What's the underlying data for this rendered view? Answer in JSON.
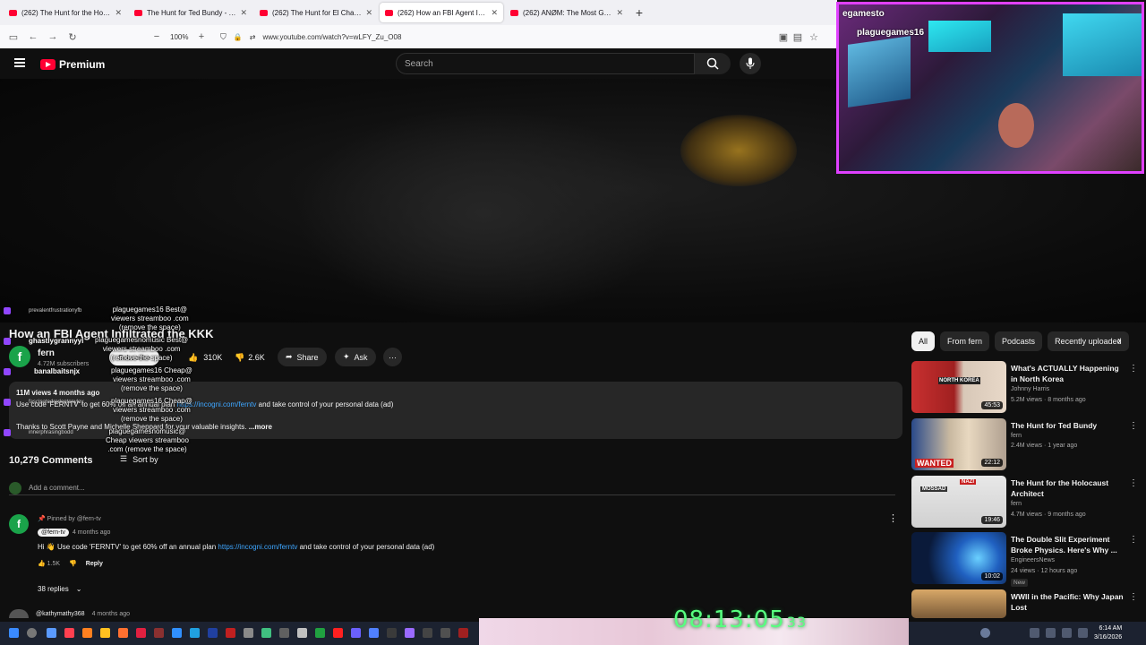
{
  "browser": {
    "tabs": [
      {
        "title": "(262) The Hunt for the Holocau",
        "active": false
      },
      {
        "title": "The Hunt for Ted Bundy - YouTu",
        "active": false
      },
      {
        "title": "(262) The Hunt for El Chapo - Y",
        "active": false
      },
      {
        "title": "(262) How an FBI Agent Infiltrat",
        "active": true
      },
      {
        "title": "(262) ANØM: The Most Genius",
        "active": false
      }
    ],
    "new_tab": "+",
    "zoom": "100%",
    "zoom_minus": "−",
    "zoom_plus": "+",
    "url": "www.youtube.com/watch?v=wLFY_Zu_O08"
  },
  "youtube": {
    "logo_text": "Premium",
    "search_placeholder": "Search"
  },
  "stream_overlay": {
    "cam_name": "egamesto",
    "cam_name2": "plaguegames16",
    "clock": "08:13:05",
    "clock_small": "33"
  },
  "video": {
    "title": "How an FBI Agent Infiltrated the KKK",
    "channel": "fern",
    "subscribers": "4.72M subscribers",
    "subscribe_label": "Subscribe",
    "likes": "310K",
    "dislikes": "2.6K",
    "share_label": "Share",
    "ask_label": "Ask",
    "more_label": "···"
  },
  "description": {
    "views": "11M views  4 months ago",
    "promo_prefix": "Use code 'FERNTV' to get 60% off an annual plan ",
    "promo_link": "https://incogni.com/ferntv",
    "promo_suffix": " and take control of your personal data (ad)",
    "thanks": "Thanks to Scott Payne and Michelle Sheppard for your valuable insights. ",
    "more": "...more"
  },
  "comments": {
    "count": "10,279 Comments",
    "sort_label": "Sort by",
    "add_placeholder": "Add a comment...",
    "pinned": {
      "pinned_label": "Pinned by @fern-tv",
      "author": "@fern-tv",
      "time": "4 months ago",
      "text_prefix": "Hi 👋 Use code 'FERNTV' to get 60% off an annual plan ",
      "link": "https://incogni.com/ferntv",
      "text_suffix": " and take control of your personal data (ad)",
      "likes": "1.5K",
      "reply_label": "Reply",
      "replies": "38 replies"
    },
    "next": {
      "author": "@kathymathy368",
      "time": "4 months ago"
    }
  },
  "chips": [
    "All",
    "From fern",
    "Podcasts",
    "Recently uploaded"
  ],
  "related": [
    {
      "title": "What's ACTUALLY Happening in North Korea",
      "channel": "Johnny Harris",
      "meta": "5.2M views · 8 months ago",
      "duration": "45:53",
      "thumb_text": "NORTH KOREA",
      "badge": ""
    },
    {
      "title": "The Hunt for Ted Bundy",
      "channel": "fern",
      "meta": "2.4M views · 1 year ago",
      "duration": "22:12",
      "thumb_text": "WANTED",
      "badge": ""
    },
    {
      "title": "The Hunt for the Holocaust Architect",
      "channel": "fern",
      "meta": "4.7M views · 9 months ago",
      "duration": "19:46",
      "thumb_text": "NAZI",
      "thumb_text2": "MOSSAD",
      "badge": ""
    },
    {
      "title": "The Double Slit Experiment Broke Physics. Here's Why ...",
      "channel": "EngineersNews",
      "meta": "24 views · 12 hours ago",
      "duration": "10:02",
      "thumb_text": "",
      "badge": "New"
    },
    {
      "title": "WWII in the Pacific: Why Japan Lost",
      "channel": "",
      "meta": "",
      "duration": "",
      "thumb_text": "",
      "badge": ""
    }
  ],
  "chat": [
    {
      "user": "prevalentfrustrationyfb",
      "msg": "plaguegames16 Best@\nviewers streamboo .com\n(remove the space)"
    },
    {
      "user": "ghastlygrannyyl",
      "msg": "plaguegamesnomusic Best@\nviewers streamboo .com\n(remove the space)"
    },
    {
      "user": "banalbaitsnjx",
      "msg": "plaguegames16 Cheap@\nviewers streamboo .com\n(remove the space)"
    },
    {
      "user": "fascinatedrodentcnyloy",
      "msg": "plaguegames16 Cheap@\nviewers streamboo .com\n(remove the space)"
    },
    {
      "user": "innerphrasingbodd",
      "msg": "plaguegamesnomusic@\nCheap viewers streamboo\n.com (remove the space)"
    }
  ],
  "taskbar": {
    "time": "6:14 AM",
    "date": "3/16/2026"
  }
}
